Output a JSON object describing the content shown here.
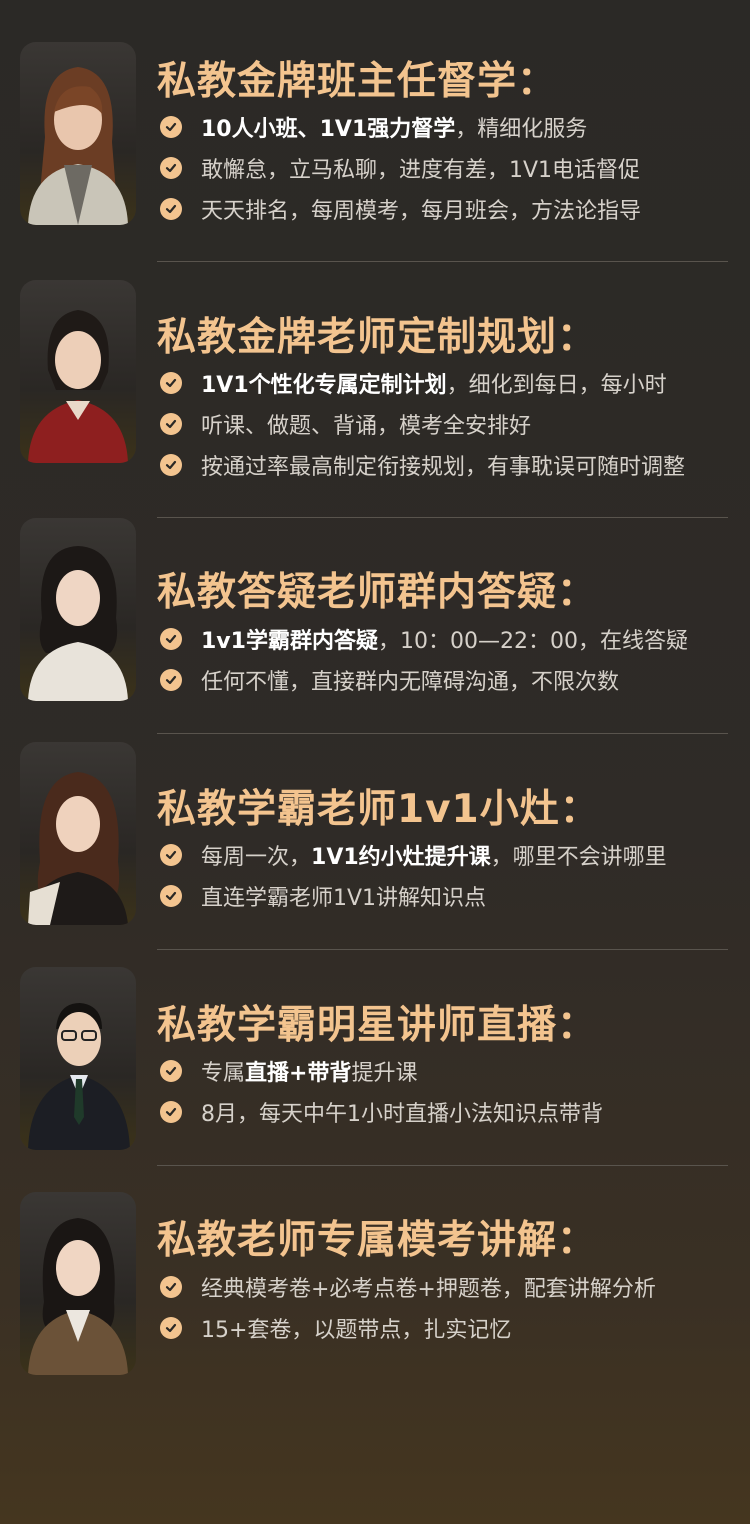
{
  "colors": {
    "accent": "#f3c48f",
    "text": "#d6d1ca",
    "highlight": "#ffffff",
    "background": "#2b2926"
  },
  "sections": [
    {
      "title": "私教金牌班主任督学：",
      "bullets": [
        {
          "hl": "10人小班、1V1强力督学",
          "rest": "，精细化服务"
        },
        {
          "hl": "",
          "rest": "敢懈怠，立马私聊，进度有差，1V1电话督促"
        },
        {
          "hl": "",
          "rest": "天天排名，每周模考，每月班会，方法论指导"
        }
      ]
    },
    {
      "title": "私教金牌老师定制规划：",
      "bullets": [
        {
          "hl": "1V1个性化专属定制计划",
          "rest": "，细化到每日，每小时"
        },
        {
          "hl": "",
          "rest": "听课、做题、背诵，模考全安排好"
        },
        {
          "hl": "",
          "rest": "按通过率最高制定衔接规划，有事耽误可随时调整"
        }
      ]
    },
    {
      "title": "私教答疑老师群内答疑：",
      "bullets": [
        {
          "hl": "1v1学霸群内答疑",
          "rest": "，10：00—22：00，在线答疑"
        },
        {
          "hl": "",
          "rest": "任何不懂，直接群内无障碍沟通，不限次数"
        }
      ]
    },
    {
      "title": "私教学霸老师1v1小灶：",
      "bullets": [
        {
          "pre": "每周一次，",
          "hl": "1V1约小灶提升课",
          "rest": "，哪里不会讲哪里"
        },
        {
          "hl": "",
          "rest": "直连学霸老师1V1讲解知识点"
        }
      ]
    },
    {
      "title": "私教学霸明星讲师直播：",
      "bullets": [
        {
          "pre": "专属",
          "hl": "直播+带背",
          "rest": "提升课"
        },
        {
          "hl": "",
          "rest": "8月，每天中午1小时直播小法知识点带背"
        }
      ]
    },
    {
      "title": "私教老师专属模考讲解：",
      "bullets": [
        {
          "hl": "",
          "rest": "经典模考卷+必考点卷+押题卷，配套讲解分析"
        },
        {
          "hl": "",
          "rest": "15+套卷，以题带点，扎实记忆"
        }
      ]
    }
  ]
}
